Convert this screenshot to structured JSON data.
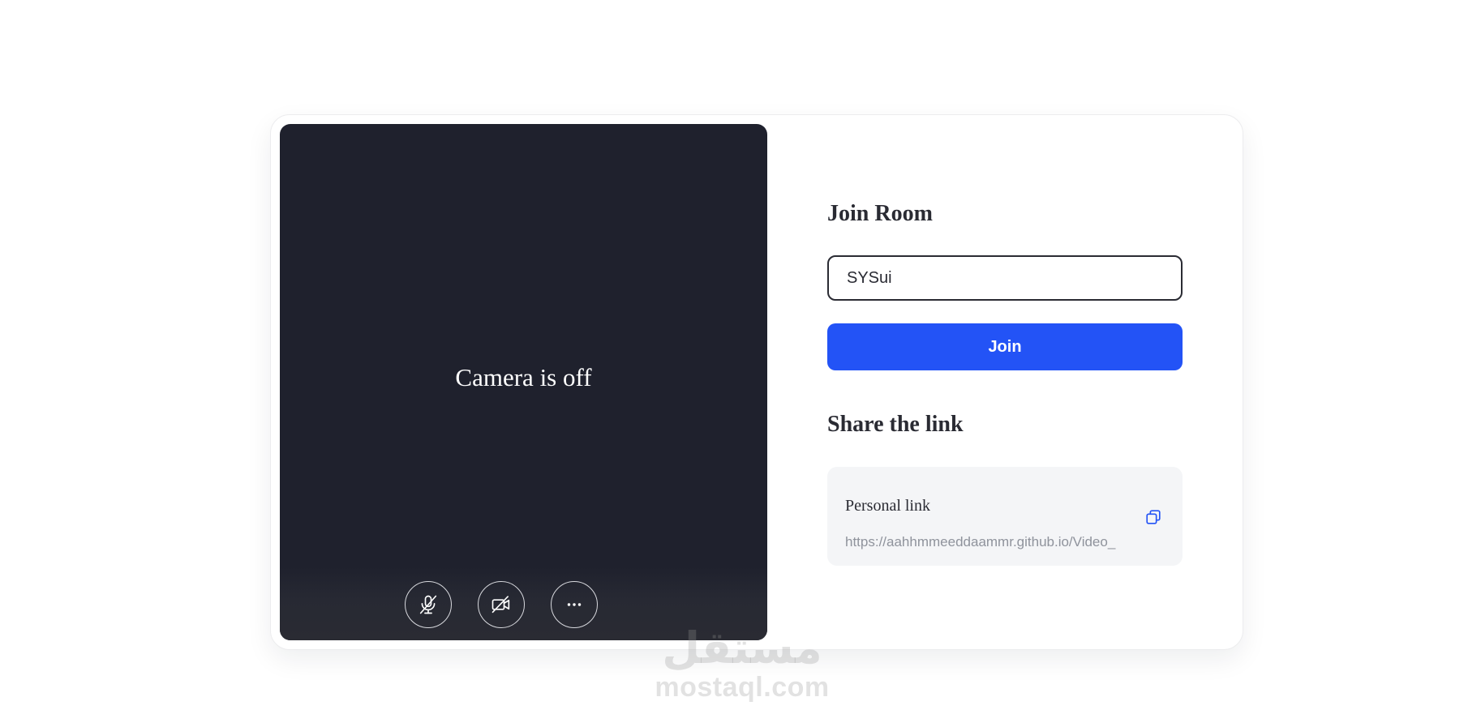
{
  "preview": {
    "camera_status": "Camera is off",
    "controls": [
      {
        "name": "mic-off-button",
        "icon": "mic-off-icon"
      },
      {
        "name": "camera-off-button",
        "icon": "video-off-icon"
      },
      {
        "name": "more-options-button",
        "icon": "more-horizontal-icon"
      }
    ]
  },
  "join": {
    "title": "Join Room",
    "room_value": "SYSui",
    "button_label": "Join"
  },
  "share": {
    "title": "Share the link",
    "link_label": "Personal link",
    "link_url": "https://aahhmmeeddaammr.github.io/Video_",
    "copy_icon": "copy-icon"
  },
  "watermark": {
    "arabic": "مستقل",
    "latin": "mostaql.com"
  },
  "colors": {
    "preview_bg": "#1f212d",
    "accent": "#2353f6",
    "text": "#2a2b33",
    "muted": "#8f939c",
    "link_box_bg": "#f4f5f7"
  }
}
